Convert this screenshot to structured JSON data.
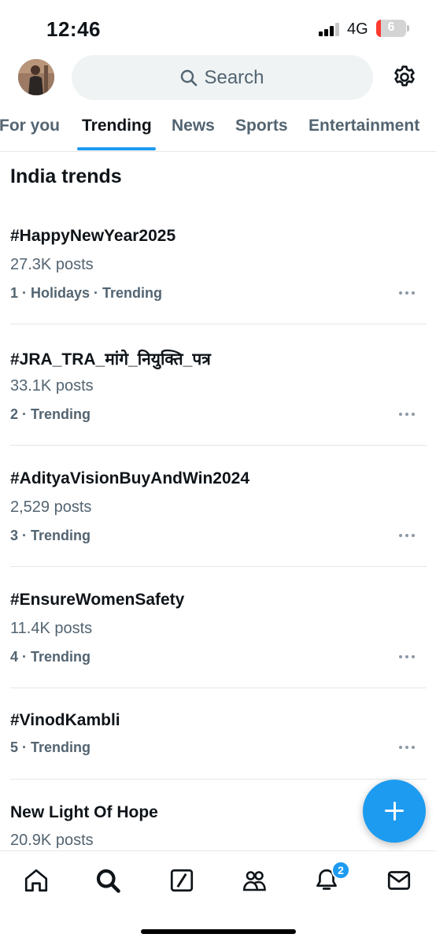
{
  "status_bar": {
    "time": "12:46",
    "network": "4G",
    "battery": "6"
  },
  "header": {
    "search_placeholder": "Search"
  },
  "tabs": [
    {
      "label": "For you"
    },
    {
      "label": "Trending",
      "active": true
    },
    {
      "label": "News"
    },
    {
      "label": "Sports"
    },
    {
      "label": "Entertainment"
    }
  ],
  "section_title": "India trends",
  "trends": [
    {
      "name": "#HappyNewYear2025",
      "posts": "27.3K posts",
      "meta": "1 · Holidays · Trending"
    },
    {
      "name": "#JRA_TRA_मांगे_नियुक्ति_पत्र",
      "posts": "33.1K posts",
      "meta": "2 · Trending"
    },
    {
      "name": "#AdityaVisionBuyAndWin2024",
      "posts": "2,529 posts",
      "meta": "3 · Trending"
    },
    {
      "name": "#EnsureWomenSafety",
      "posts": "11.4K posts",
      "meta": "4 · Trending"
    },
    {
      "name": "#VinodKambli",
      "posts": "",
      "meta": "5 · Trending"
    },
    {
      "name": "New Light Of Hope",
      "posts": "20.9K posts",
      "meta": ""
    }
  ],
  "bottom_nav": {
    "items": [
      {
        "icon": "home-icon"
      },
      {
        "icon": "search-icon"
      },
      {
        "icon": "grok-icon"
      },
      {
        "icon": "communities-icon"
      },
      {
        "icon": "notifications-icon"
      },
      {
        "icon": "messages-icon"
      }
    ],
    "notifications_badge": "2"
  },
  "colors": {
    "accent": "#1d9bf0",
    "text_primary": "#0f1419",
    "text_secondary": "#536471"
  }
}
